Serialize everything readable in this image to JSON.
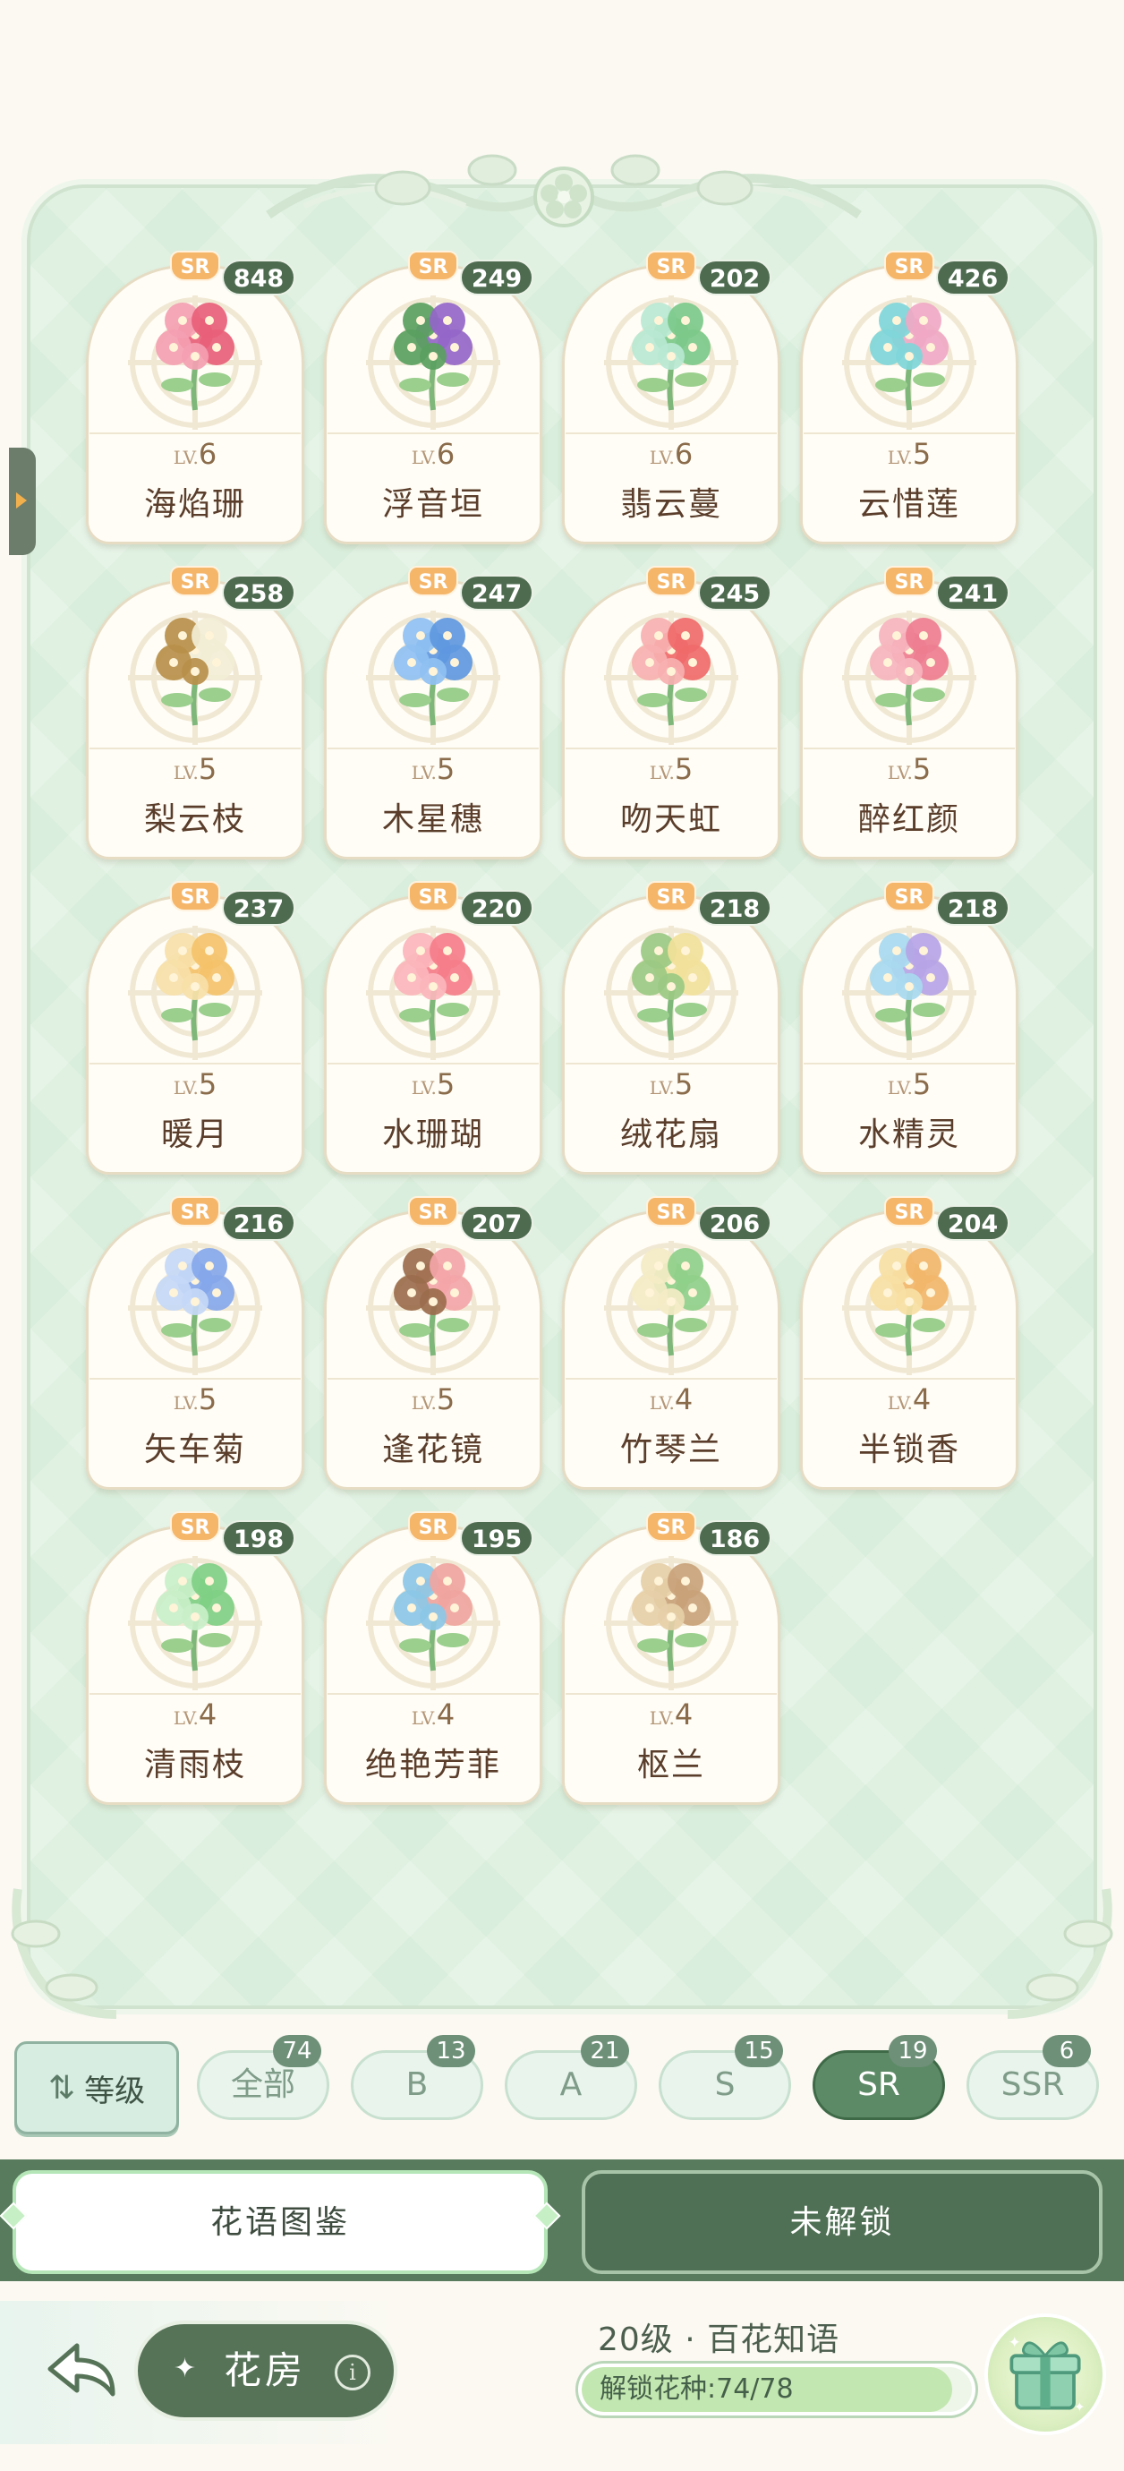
{
  "cards": [
    {
      "badge": "SR",
      "count": "848",
      "level_prefix": "LV.",
      "level": "6",
      "name": "海焰珊",
      "color": "#e8607a",
      "accent": "#f4a0b2"
    },
    {
      "badge": "SR",
      "count": "249",
      "level_prefix": "LV.",
      "level": "6",
      "name": "浮音垣",
      "color": "#9466c9",
      "accent": "#5aa05f"
    },
    {
      "badge": "SR",
      "count": "202",
      "level_prefix": "LV.",
      "level": "6",
      "name": "翡云蔓",
      "color": "#7cc98a",
      "accent": "#b9e8d2"
    },
    {
      "badge": "SR",
      "count": "426",
      "level_prefix": "LV.",
      "level": "5",
      "name": "云惜莲",
      "color": "#f0a8c4",
      "accent": "#7fd6d9"
    },
    {
      "badge": "SR",
      "count": "258",
      "level_prefix": "LV.",
      "level": "5",
      "name": "梨云枝",
      "color": "#f2eed6",
      "accent": "#b98f4a"
    },
    {
      "badge": "SR",
      "count": "247",
      "level_prefix": "LV.",
      "level": "5",
      "name": "木星穗",
      "color": "#5f98e0",
      "accent": "#8fc0f2"
    },
    {
      "badge": "SR",
      "count": "245",
      "level_prefix": "LV.",
      "level": "5",
      "name": "吻天虹",
      "color": "#f06a6a",
      "accent": "#f7b0b0"
    },
    {
      "badge": "SR",
      "count": "241",
      "level_prefix": "LV.",
      "level": "5",
      "name": "醉红颜",
      "color": "#ee7d90",
      "accent": "#f6b4be"
    },
    {
      "badge": "SR",
      "count": "237",
      "level_prefix": "LV.",
      "level": "5",
      "name": "暖月",
      "color": "#f4c26a",
      "accent": "#f7e0a8"
    },
    {
      "badge": "SR",
      "count": "220",
      "level_prefix": "LV.",
      "level": "5",
      "name": "水珊瑚",
      "color": "#f57d8a",
      "accent": "#fbb5bb"
    },
    {
      "badge": "SR",
      "count": "218",
      "level_prefix": "LV.",
      "level": "5",
      "name": "绒花扇",
      "color": "#f2e19a",
      "accent": "#9bc983"
    },
    {
      "badge": "SR",
      "count": "218",
      "level_prefix": "LV.",
      "level": "5",
      "name": "水精灵",
      "color": "#b6a4e6",
      "accent": "#a8d9ef"
    },
    {
      "badge": "SR",
      "count": "216",
      "level_prefix": "LV.",
      "level": "5",
      "name": "矢车菊",
      "color": "#86a7ea",
      "accent": "#c6d8f6"
    },
    {
      "badge": "SR",
      "count": "207",
      "level_prefix": "LV.",
      "level": "5",
      "name": "逢花镜",
      "color": "#f3a5a8",
      "accent": "#9b6d4d"
    },
    {
      "badge": "SR",
      "count": "206",
      "level_prefix": "LV.",
      "level": "4",
      "name": "竹琴兰",
      "color": "#8fcf8a",
      "accent": "#f4ecc6"
    },
    {
      "badge": "SR",
      "count": "204",
      "level_prefix": "LV.",
      "level": "4",
      "name": "半锁香",
      "color": "#f2b66a",
      "accent": "#f7dfa4"
    },
    {
      "badge": "SR",
      "count": "198",
      "level_prefix": "LV.",
      "level": "4",
      "name": "清雨枝",
      "color": "#7fcf86",
      "accent": "#c9efc9"
    },
    {
      "badge": "SR",
      "count": "195",
      "level_prefix": "LV.",
      "level": "4",
      "name": "绝艳芳菲",
      "color": "#f0a4a0",
      "accent": "#8cc7e6"
    },
    {
      "badge": "SR",
      "count": "186",
      "level_prefix": "LV.",
      "level": "4",
      "name": "枢兰",
      "color": "#c9a27a",
      "accent": "#e6cfa8"
    }
  ],
  "filters": {
    "sort_label": "等级",
    "pills": [
      {
        "label": "全部",
        "count": "74"
      },
      {
        "label": "B",
        "count": "13"
      },
      {
        "label": "A",
        "count": "21"
      },
      {
        "label": "S",
        "count": "15"
      },
      {
        "label": "SR",
        "count": "19",
        "active": true
      },
      {
        "label": "SSR",
        "count": "6"
      }
    ]
  },
  "tabs": {
    "active": "花语图鉴",
    "inactive": "未解锁"
  },
  "bottom": {
    "room_label": "花房",
    "info_symbol": "i",
    "level_title": "20级 · 百花知语",
    "progress_label": "解锁花种:74/78",
    "progress_fraction": 0.9487
  },
  "icons": {
    "back": "back-arrow-icon",
    "sort": "sort-arrows-icon",
    "gift": "gift-box-icon",
    "info": "info-icon"
  },
  "colors": {
    "board": "#d9eedc",
    "accent_green": "#567358",
    "sr_badge": "#f5b66a",
    "count_badge": "#4e6b50"
  }
}
